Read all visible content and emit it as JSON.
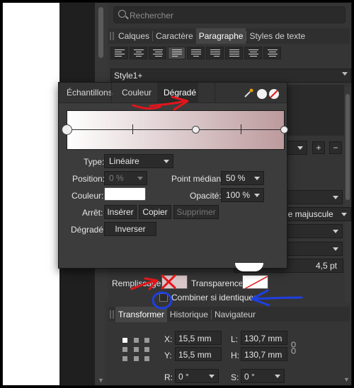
{
  "search": {
    "placeholder": "Rechercher"
  },
  "top_tabs": [
    "Calques",
    "Caractère",
    "Paragraphe",
    "Styles de texte"
  ],
  "top_tabs_active": 2,
  "paragraph_style": "Style1+",
  "gradient_panel": {
    "tabs": [
      "Échantillons",
      "Couleur",
      "Dégradé"
    ],
    "active_tab": 2,
    "type_label": "Type:",
    "type_value": "Linéaire",
    "position_label": "Position:",
    "position_value": "0 %",
    "midpoint_label": "Point médian:",
    "midpoint_value": "50 %",
    "color_label": "Couleur:",
    "opacity_label": "Opacité:",
    "opacity_value": "100 %",
    "stop_label": "Arrêt:",
    "insert_button": "Insérer",
    "copy_button": "Copier",
    "delete_button": "Supprimer",
    "gradient_label": "Dégradé:",
    "reverse_button": "Inverser",
    "gradient_start_color": "#ffffff",
    "gradient_end_color": "#bc9a9d"
  },
  "right_panel": {
    "dropdown_partial": "de majuscule",
    "size_value": "4,5 pt",
    "fill_label": "Remplissage:",
    "transparency_label": "Transparence:",
    "combine_label": "Combiner si identiques"
  },
  "bottom_tabs": [
    "Transformer",
    "Historique",
    "Navigateur"
  ],
  "bottom_tabs_active": 0,
  "transform": {
    "x_label": "X:",
    "x_value": "15,5 mm",
    "y_label": "Y:",
    "y_value": "15,5 mm",
    "l_label": "L:",
    "l_value": "130,7 mm",
    "h_label": "H:",
    "h_value": "130,7 mm",
    "r_label": "R:",
    "r_value": "0 °",
    "s_label": "S:",
    "s_value": "0 °"
  },
  "colors": {
    "annotation_red": "#e4141b",
    "annotation_blue": "#1f3fe0",
    "panel_bg": "#353535"
  }
}
